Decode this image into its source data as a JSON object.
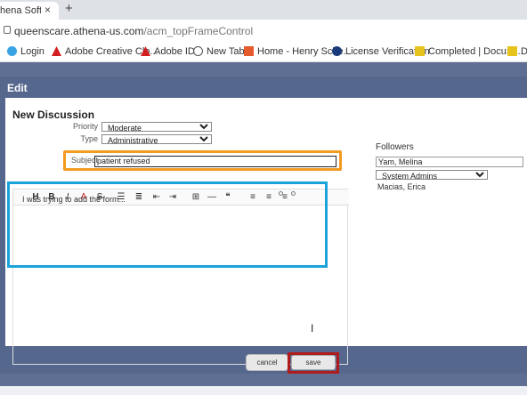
{
  "browser": {
    "tab_title": "hena Softwa",
    "new_tab_symbol": "+",
    "close_symbol": "×",
    "url_host": "queenscare.athena-us.com",
    "url_path": "/acm_topFrameControl"
  },
  "bookmarks": [
    {
      "label": "Login",
      "color": "#3aa3e3"
    },
    {
      "label": "Adobe Creative Clo...",
      "color": "#d21f1f"
    },
    {
      "label": "Adobe ID",
      "color": "#d21f1f"
    },
    {
      "label": "New Tab",
      "color": "#555555"
    },
    {
      "label": "Home - Henry Sche...",
      "color": "#e65b2d"
    },
    {
      "label": "License Verification",
      "color": "#1a3a7a"
    },
    {
      "label": "Completed | DocuSi...",
      "color": "#e7c31d"
    },
    {
      "label": "Do",
      "color": "#e7c31d"
    }
  ],
  "dialog": {
    "title": "Edit",
    "panel_title": "New Discussion",
    "priority_label": "Priority",
    "priority_value": "Moderate",
    "type_label": "Type",
    "type_value": "Administrative",
    "subject_label": "Subject",
    "subject_value": "patient refused",
    "content_text": "I was trying to add the form...",
    "followers_title": "Followers",
    "follower_input": "Yam, Melina",
    "follower_group": "System Admins",
    "follower_name": "Macias, Erica",
    "cancel_label": "cancel",
    "save_label": "save"
  },
  "toolbar": {
    "heading": "H",
    "bold": "B",
    "italic": "I",
    "color": "A",
    "strike": "S",
    "bullets": "☰",
    "numbers": "≣",
    "outdent": "⇤",
    "indent": "⇥",
    "table": "⊞",
    "hr": "—",
    "quote": "❝",
    "align_left": "≡",
    "align_center": "≡",
    "align_right": "≡"
  },
  "colors": {
    "dialog_bg": "#56678e",
    "subject_highlight": "#f39a21",
    "content_highlight": "#1aa3d9",
    "save_highlight": "#b01c1c"
  }
}
